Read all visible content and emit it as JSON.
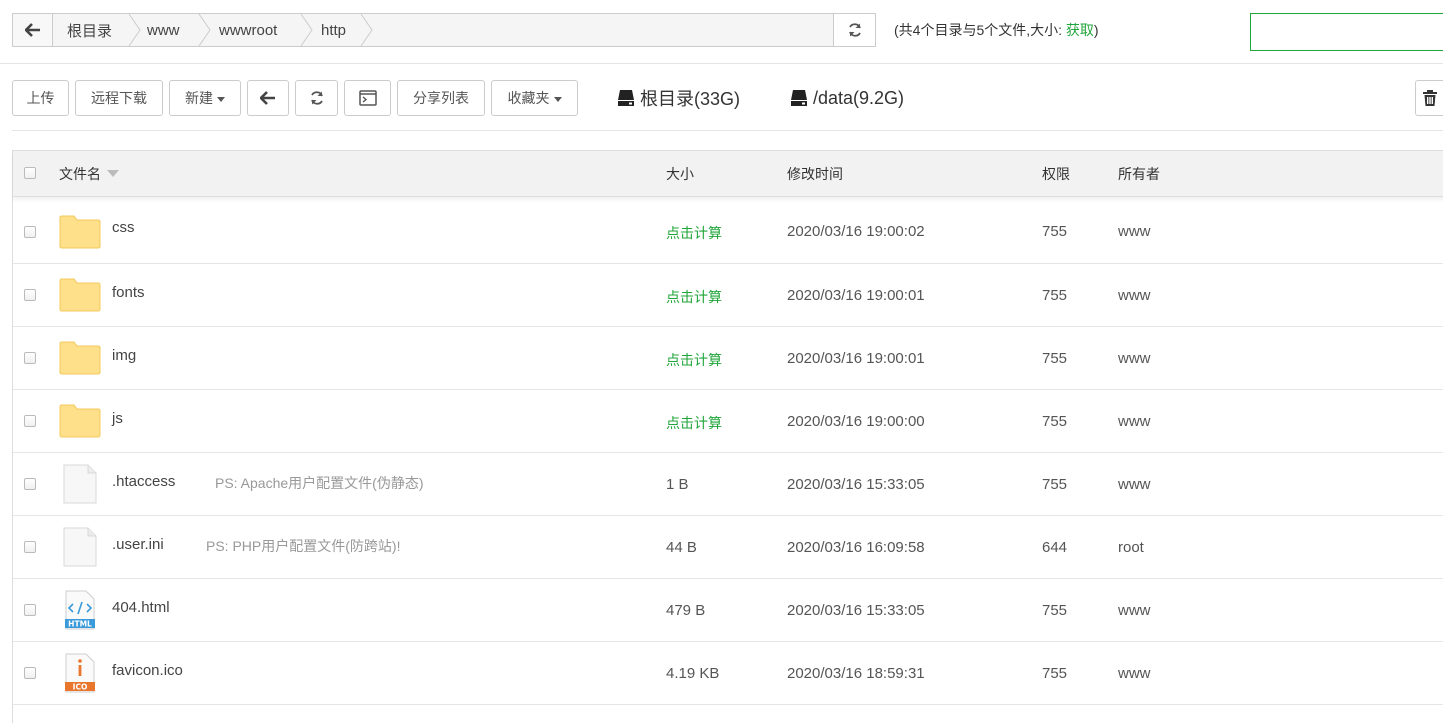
{
  "pathbar": {
    "crumbs": [
      "根目录",
      "www",
      "wwwroot",
      "http"
    ],
    "back_icon": "arrow-left-icon",
    "refresh_icon": "refresh-icon"
  },
  "summary": {
    "text": "(共4个目录与5个文件,大小: ",
    "link": "获取",
    "tail": ")"
  },
  "search": {
    "value": ""
  },
  "toolbar": {
    "upload": "上传",
    "remote_download": "远程下载",
    "new": "新建",
    "share_list": "分享列表",
    "favorites": "收藏夹",
    "icons": [
      "arrow-left-icon",
      "refresh-icon",
      "terminal-icon",
      "trash-icon"
    ]
  },
  "disks": [
    {
      "label": "根目录(33G)",
      "icon": "disk-icon"
    },
    {
      "label": "/data(9.2G)",
      "icon": "disk-icon"
    }
  ],
  "table": {
    "headers": {
      "name": "文件名",
      "size": "大小",
      "time": "修改时间",
      "perm": "权限",
      "owner": "所有者"
    },
    "rows": [
      {
        "name": "css",
        "type": "folder",
        "size": "点击计算",
        "time": "2020/03/16 19:00:02",
        "perm": "755",
        "owner": "www"
      },
      {
        "name": "fonts",
        "type": "folder",
        "size": "点击计算",
        "time": "2020/03/16 19:00:01",
        "perm": "755",
        "owner": "www"
      },
      {
        "name": "img",
        "type": "folder",
        "size": "点击计算",
        "time": "2020/03/16 19:00:01",
        "perm": "755",
        "owner": "www"
      },
      {
        "name": "js",
        "type": "folder",
        "size": "点击计算",
        "time": "2020/03/16 19:00:00",
        "perm": "755",
        "owner": "www"
      },
      {
        "name": ".htaccess",
        "type": "file",
        "ps": "PS: Apache用户配置文件(伪静态)",
        "size": "1 B",
        "time": "2020/03/16 15:33:05",
        "perm": "755",
        "owner": "www"
      },
      {
        "name": ".user.ini",
        "type": "file",
        "ps": "PS: PHP用户配置文件(防跨站)!",
        "size": "44 B",
        "time": "2020/03/16 16:09:58",
        "perm": "644",
        "owner": "root"
      },
      {
        "name": "404.html",
        "type": "html",
        "icon_label": "HTML",
        "size": "479 B",
        "time": "2020/03/16 15:33:05",
        "perm": "755",
        "owner": "www"
      },
      {
        "name": "favicon.ico",
        "type": "ico",
        "icon_label": "ICO",
        "size": "4.19 KB",
        "time": "2020/03/16 18:59:31",
        "perm": "755",
        "owner": "www"
      }
    ]
  },
  "colors": {
    "accent": "#20a53a",
    "folder": "#ffe08a",
    "html_icon": "#3b9ad9",
    "ico_icon": "#e8762d"
  }
}
